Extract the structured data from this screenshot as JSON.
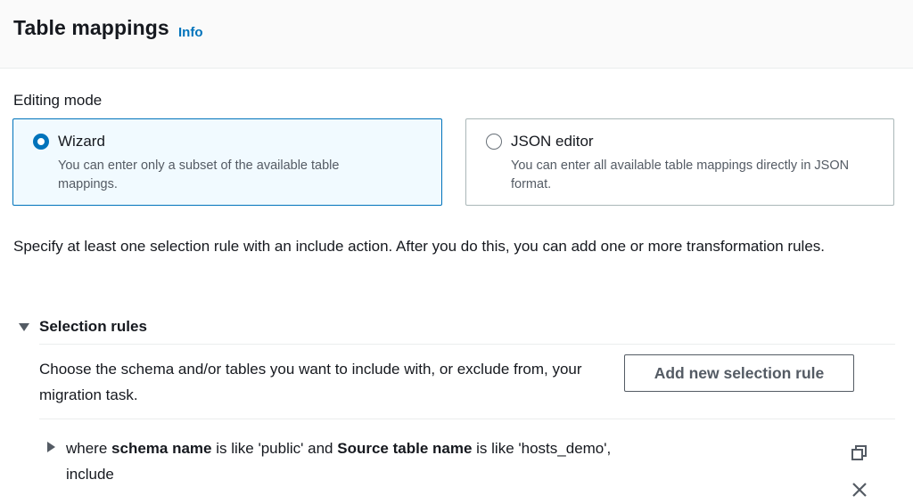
{
  "header": {
    "title": "Table mappings",
    "info_label": "Info"
  },
  "editing_mode": {
    "label": "Editing mode",
    "options": [
      {
        "title": "Wizard",
        "description": "You can enter only a subset of the available table mappings.",
        "selected": true
      },
      {
        "title": "JSON editor",
        "description": "You can enter all available table mappings directly in JSON format.",
        "selected": false
      }
    ]
  },
  "instructions": "Specify at least one selection rule with an include action. After you do this, you can add one or more transformation rules.",
  "selection_rules": {
    "title": "Selection rules",
    "description": "Choose the schema and/or tables you want to include with, or exclude from, your migration task.",
    "add_button_label": "Add new selection rule",
    "rules": [
      {
        "prefix": "where",
        "schema_label": "schema name",
        "schema_connector": "is like",
        "schema_value": "'public'",
        "joiner": "and",
        "table_label": "Source table name",
        "table_connector": "is like",
        "table_value": "'hosts_demo',",
        "action": "include"
      }
    ]
  },
  "icons": {
    "copy": "copy-icon",
    "remove": "close-icon"
  },
  "colors": {
    "accent": "#0073bb",
    "selected_tile_bg": "#f1faff",
    "text": "#16191f",
    "secondary_text": "#545b64"
  }
}
